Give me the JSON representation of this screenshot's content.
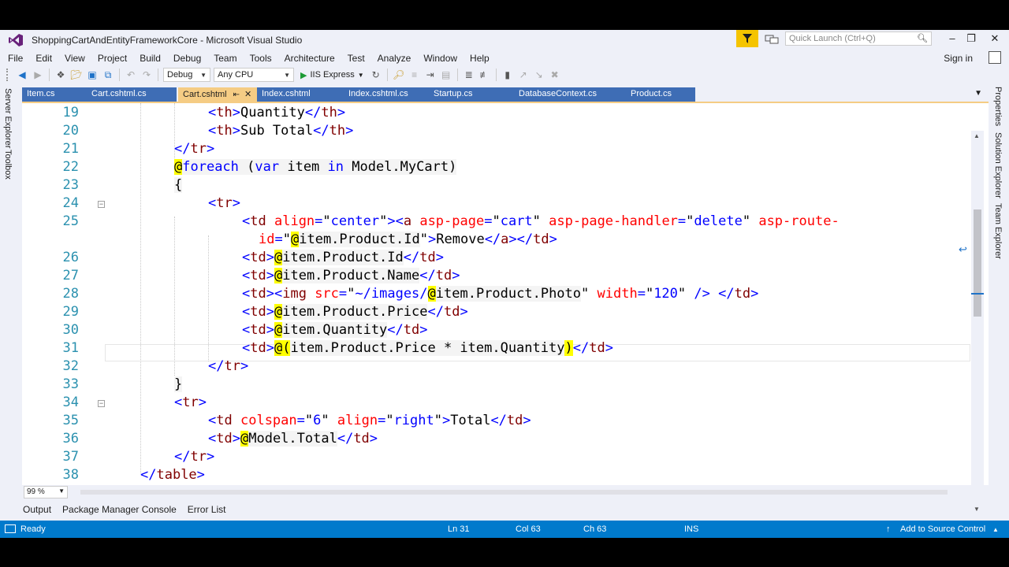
{
  "window": {
    "title": "ShoppingCartAndEntityFrameworkCore - Microsoft Visual Studio",
    "quick_launch_placeholder": "Quick Launch (Ctrl+Q)",
    "sign_in": "Sign in"
  },
  "menu": [
    "File",
    "Edit",
    "View",
    "Project",
    "Build",
    "Debug",
    "Team",
    "Tools",
    "Architecture",
    "Test",
    "Analyze",
    "Window",
    "Help"
  ],
  "toolbar": {
    "configuration": "Debug",
    "platform": "Any CPU",
    "run_target": "IIS Express"
  },
  "side_tabs": {
    "left": [
      "Server Explorer",
      "Toolbox"
    ],
    "right": [
      "Properties",
      "Solution Explorer",
      "Team Explorer"
    ]
  },
  "tabs": [
    {
      "label": "Item.cs",
      "active": false
    },
    {
      "label": "Cart.cshtml.cs",
      "active": false
    },
    {
      "label": "Cart.cshtml",
      "active": true
    },
    {
      "label": "Index.cshtml",
      "active": false
    },
    {
      "label": "Index.cshtml.cs",
      "active": false
    },
    {
      "label": "Startup.cs",
      "active": false
    },
    {
      "label": "DatabaseContext.cs",
      "active": false
    },
    {
      "label": "Product.cs",
      "active": false
    }
  ],
  "editor": {
    "line_numbers": [
      "19",
      "20",
      "21",
      "22",
      "23",
      "24",
      "25",
      "26",
      "27",
      "28",
      "29",
      "30",
      "31",
      "32",
      "33",
      "34",
      "35",
      "36",
      "37",
      "38"
    ],
    "zoom": "99 %"
  },
  "bottom_tabs": [
    "Output",
    "Package Manager Console",
    "Error List"
  ],
  "status": {
    "state": "Ready",
    "line": "Ln 31",
    "col": "Col 63",
    "ch": "Ch 63",
    "mode": "INS",
    "source_control": "Add to Source Control"
  },
  "colors": {
    "status_bar": "#007acc",
    "active_tab": "#f5cc84",
    "inactive_tab": "#3e6db5",
    "filter_button": "#f5c400",
    "line_number": "#2b91af",
    "html_tag": "#800000",
    "attribute": "#ff0000",
    "attr_value": "#0000ff",
    "razor_highlight": "#ffff00"
  }
}
